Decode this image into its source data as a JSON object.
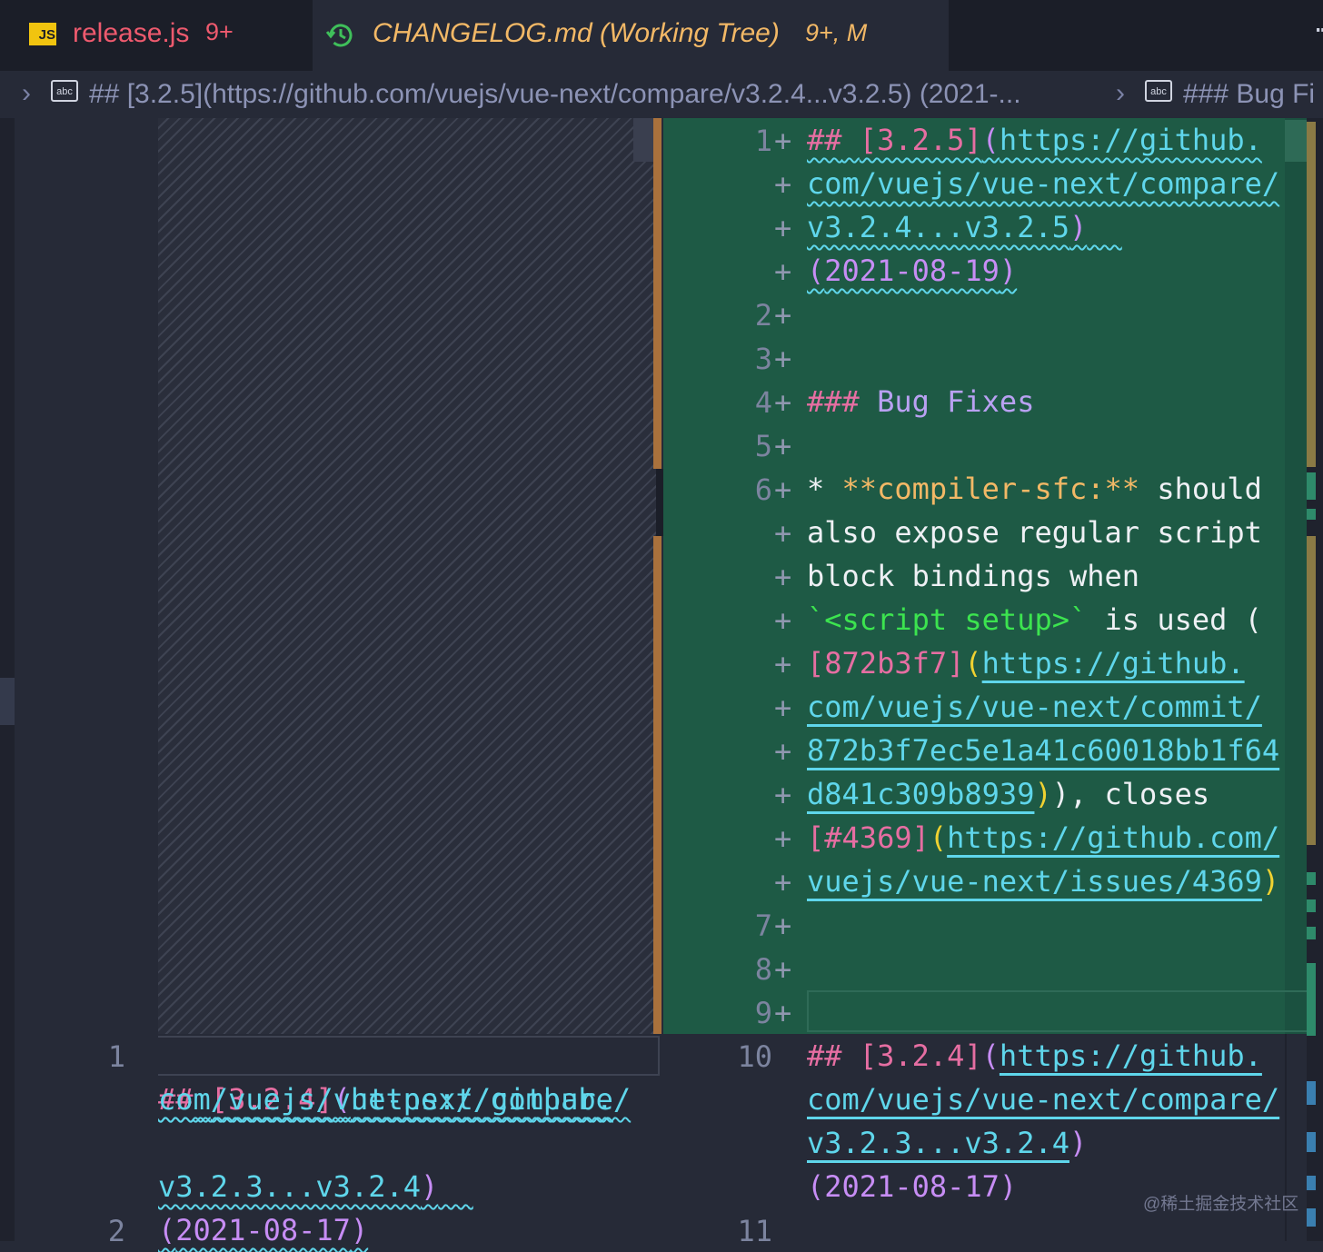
{
  "tabs": [
    {
      "icon": "js-file-icon",
      "icon_text": "JS",
      "name": "release.js",
      "badge": "9+"
    },
    {
      "icon": "history-icon",
      "name": "CHANGELOG.md (Working Tree)",
      "badge": "9+, M"
    }
  ],
  "tabbar": {
    "more": "⋯"
  },
  "breadcrumbs": [
    {
      "icon_text": "abc",
      "text": "## [3.2.5](https://github.com/vuejs/vue-next/compare/v3.2.4...v3.2.5) (2021-..."
    },
    {
      "icon_text": "abc",
      "text": "### Bug Fi"
    }
  ],
  "left_pane": {
    "line_numbers": [
      "1",
      "2"
    ],
    "code": {
      "l1a": "##",
      "l1b": "[3.2.4]",
      "l1c": "(",
      "l1d": "https://github.",
      "l2": "com/vuejs/vue-next/compare/",
      "l3a": "v3.2.3...v3.2.4",
      "l3b": ")",
      "l4a": "(",
      "l4b": "2021-08-17",
      "l4c": ")"
    }
  },
  "right_pane": {
    "line_numbers": [
      "1",
      "2",
      "3",
      "4",
      "5",
      "6",
      "7",
      "8",
      "9",
      "10",
      "11"
    ],
    "plus": "+",
    "added": {
      "h1": "##",
      "h1v": "[3.2.5]",
      "h1p": "(",
      "h1u": "https://github.",
      "h2": "com/vuejs/vue-next/compare/",
      "h3a": "v3.2.4...v3.2.5",
      "h3b": ")",
      "h4a": "(",
      "h4b": "2021-08-19",
      "h4c": ")",
      "bug_hash": "###",
      "bug_text": "Bug Fixes",
      "b1a": "*",
      "b1b": "**compiler-sfc:**",
      "b1c": "should",
      "b2": "also expose regular script",
      "b3": "block bindings when",
      "b4a": "`<script setup>`",
      "b4b": " is used (",
      "b5a": "[872b3f7]",
      "b5b": "(",
      "b5c": "https://github.",
      "b6": "com/vuejs/vue-next/commit/",
      "b7": "872b3f7ec5e1a41c60018bb1f64",
      "b8a": "d841c309b8939",
      "b8b": ")",
      "b8c": "), closes",
      "b9a": "[#4369]",
      "b9b": "(",
      "b9c": "https://github.com/",
      "b10a": "vuejs/vue-next/issues/4369",
      "b10b": ")"
    },
    "context": {
      "c1a": "##",
      "c1b": "[3.2.4]",
      "c1c": "(",
      "c1d": "https://github.",
      "c2": "com/vuejs/vue-next/compare/",
      "c3a": "v3.2.3...v3.2.4",
      "c3b": ")",
      "c4a": "(",
      "c4b": "2021-08-17",
      "c4c": ")"
    }
  },
  "watermark": "@稀土掘金技术社区"
}
